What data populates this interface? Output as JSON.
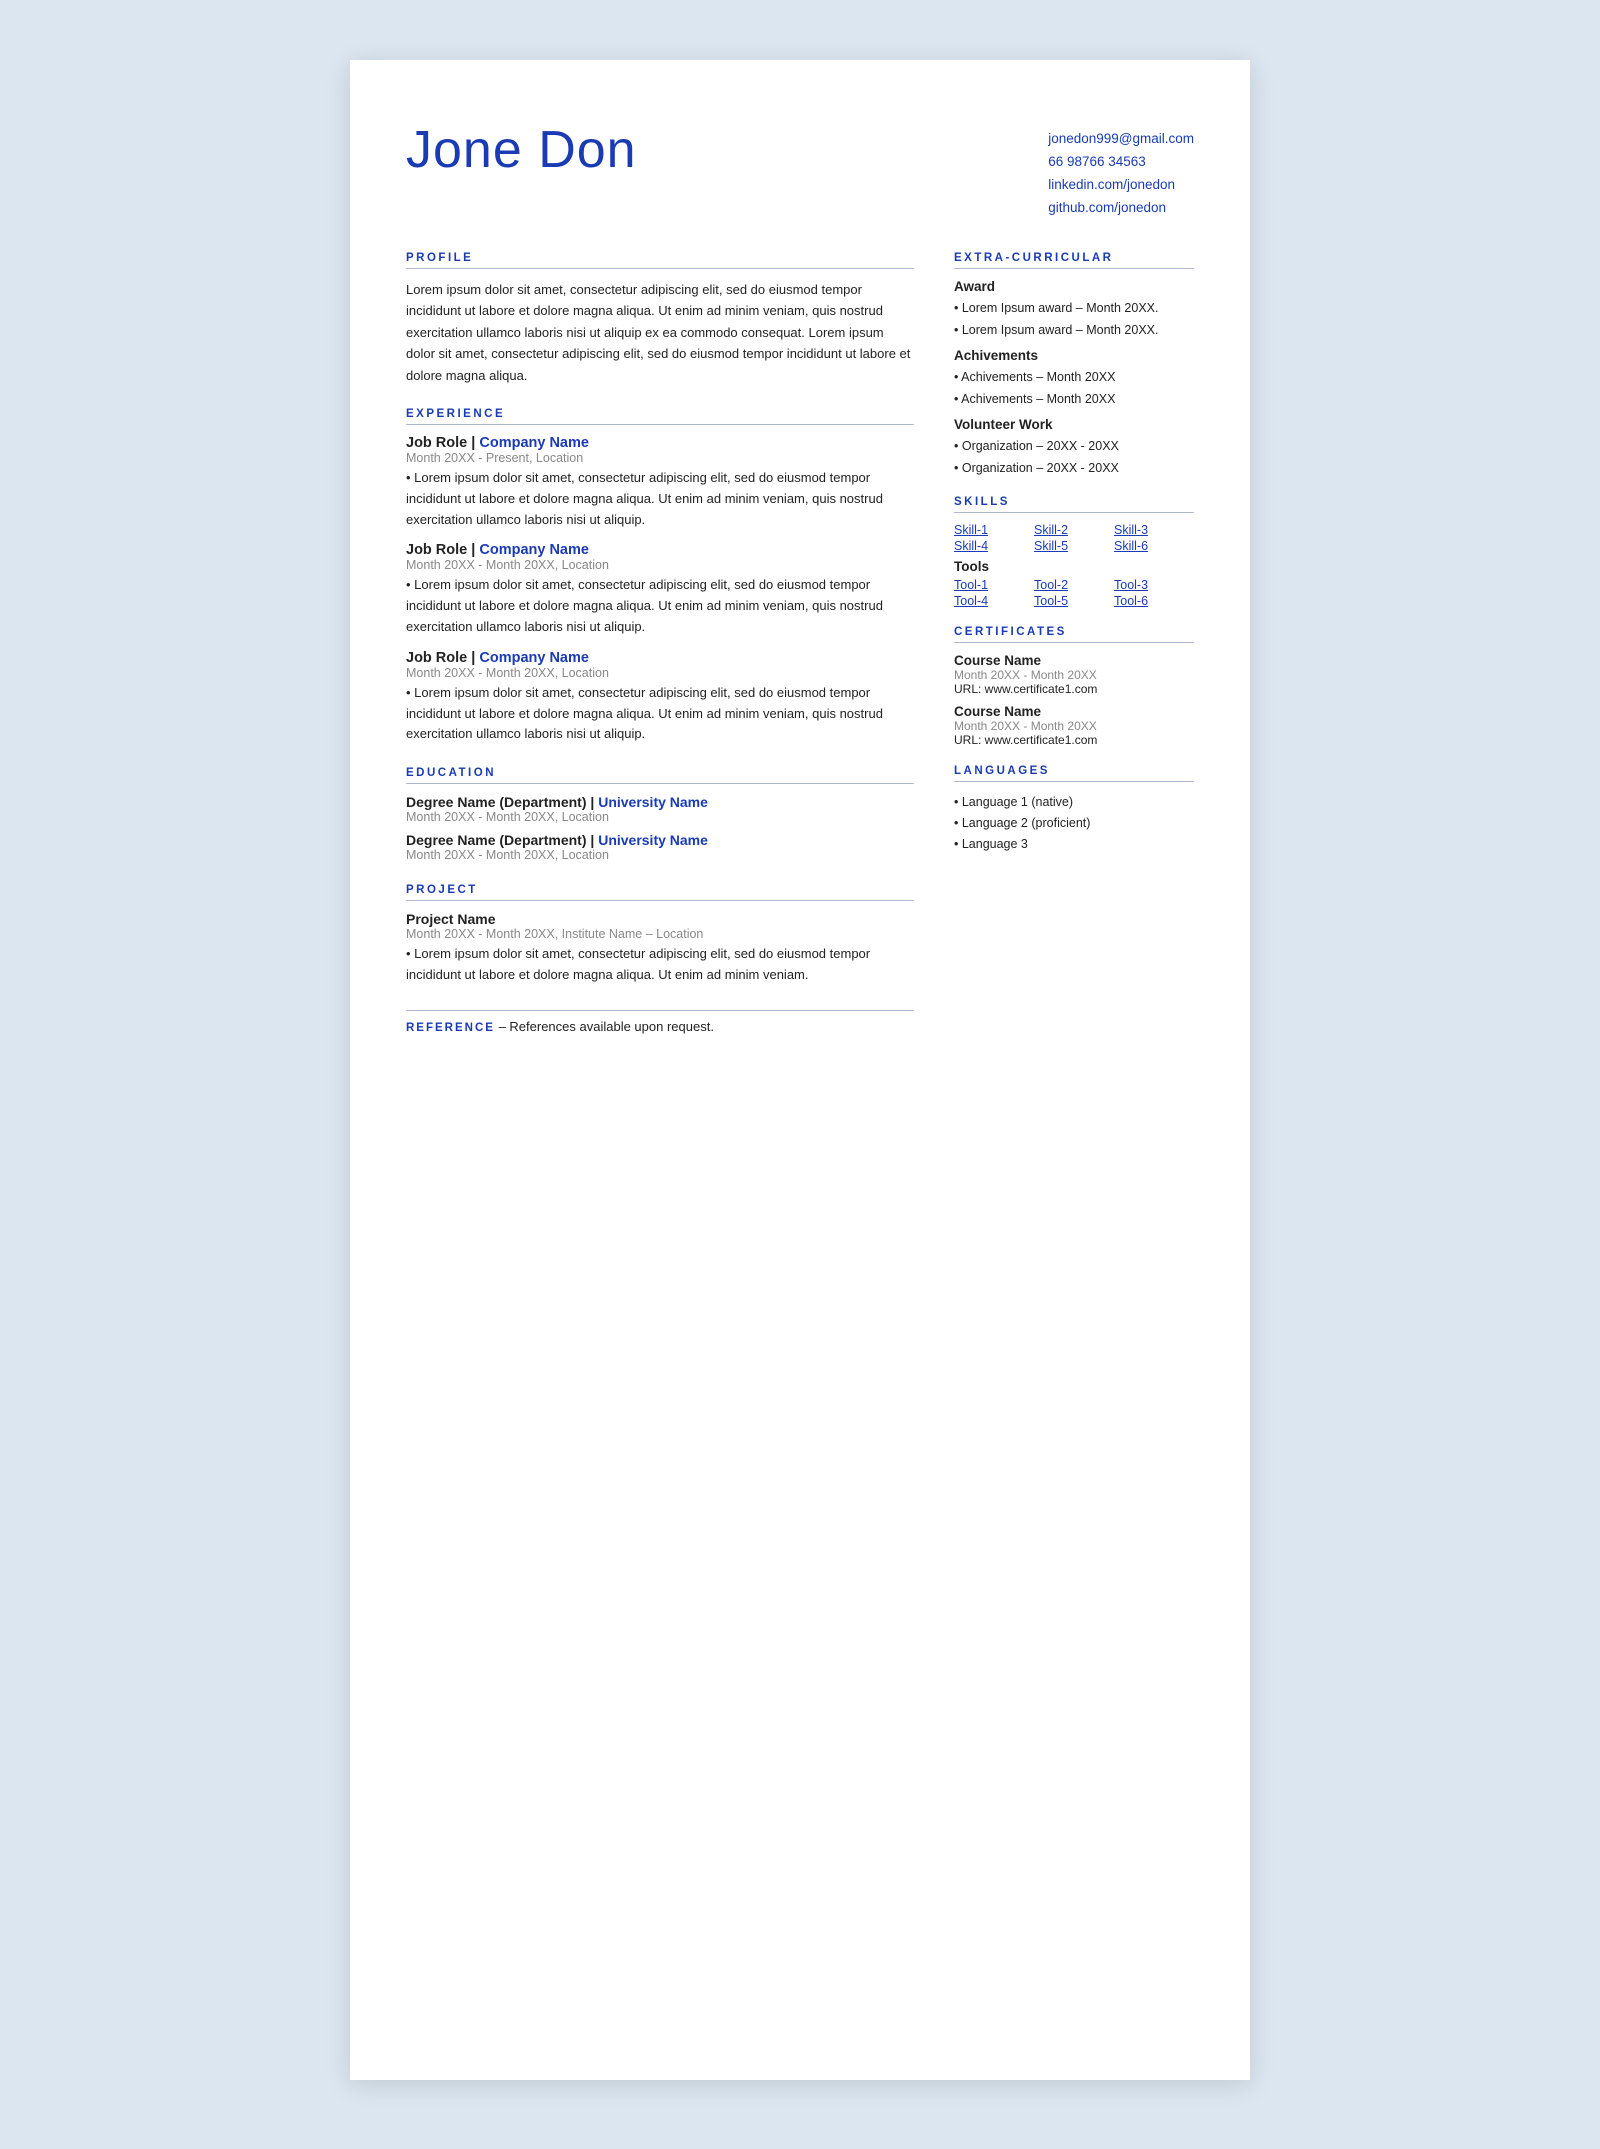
{
  "resume": {
    "name": "Jone Don",
    "contact": {
      "email": "jonedon999@gmail.com",
      "phone": "66 98766 34563",
      "linkedin": "linkedin.com/jonedon",
      "github": "github.com/jonedon"
    },
    "profile": {
      "section_title": "PROFILE",
      "text": "Lorem ipsum dolor sit amet, consectetur adipiscing elit, sed do eiusmod tempor incididunt ut labore et dolore magna aliqua. Ut enim ad minim veniam, quis nostrud exercitation ullamco laboris nisi ut aliquip ex ea commodo consequat. Lorem ipsum dolor sit amet, consectetur adipiscing elit, sed do eiusmod tempor incididunt ut labore et dolore magna aliqua."
    },
    "experience": {
      "section_title": "EXPERIENCE",
      "jobs": [
        {
          "role": "Job Role",
          "company": "Company Name",
          "date": "Month 20XX - Present, Location",
          "desc": "• Lorem ipsum dolor sit amet, consectetur adipiscing elit, sed do eiusmod tempor incididunt ut labore et dolore magna aliqua. Ut enim ad minim veniam, quis nostrud exercitation ullamco laboris nisi ut aliquip."
        },
        {
          "role": "Job Role",
          "company": "Company Name",
          "date": "Month 20XX - Month 20XX, Location",
          "desc": "• Lorem ipsum dolor sit amet, consectetur adipiscing elit, sed do eiusmod tempor incididunt ut labore et dolore magna aliqua. Ut enim ad minim veniam, quis nostrud exercitation ullamco laboris nisi ut aliquip."
        },
        {
          "role": "Job Role",
          "company": "Company Name",
          "date": "Month 20XX - Month 20XX, Location",
          "desc": "• Lorem ipsum dolor sit amet, consectetur adipiscing elit, sed do eiusmod tempor incididunt ut labore et dolore magna aliqua. Ut enim ad minim veniam, quis nostrud exercitation ullamco laboris nisi ut aliquip."
        }
      ]
    },
    "education": {
      "section_title": "EDUCATION",
      "degrees": [
        {
          "degree": "Degree Name (Department)",
          "university": "University Name",
          "date": "Month 20XX - Month 20XX, Location"
        },
        {
          "degree": "Degree Name (Department)",
          "university": "University Name",
          "date": "Month 20XX - Month 20XX, Location"
        }
      ]
    },
    "project": {
      "section_title": "PROJECT",
      "name": "Project Name",
      "date": "Month 20XX - Month 20XX, Institute Name – Location",
      "desc": "• Lorem ipsum dolor sit amet, consectetur adipiscing elit, sed do eiusmod tempor incididunt ut labore et dolore magna aliqua. Ut enim ad minim veniam."
    },
    "reference": {
      "label": "REFERENCE",
      "text": "– References available upon request."
    },
    "extra_curricular": {
      "section_title": "EXTRA-CURRICULAR",
      "award_label": "Award",
      "awards": [
        "• Lorem Ipsum award – Month 20XX.",
        "• Lorem Ipsum award – Month 20XX."
      ],
      "achievements_label": "Achivements",
      "achievements": [
        "• Achivements – Month 20XX",
        "• Achivements – Month 20XX"
      ],
      "volunteer_label": "Volunteer Work",
      "volunteer": [
        "• Organization – 20XX - 20XX",
        "• Organization – 20XX - 20XX"
      ]
    },
    "skills": {
      "section_title": "SKILLS",
      "skills": [
        "Skill-1",
        "Skill-2",
        "Skill-3",
        "Skill-4",
        "Skill-5",
        "Skill-6"
      ],
      "tools_label": "Tools",
      "tools": [
        "Tool-1",
        "Tool-2",
        "Tool-3",
        "Tool-4",
        "Tool-5",
        "Tool-6"
      ]
    },
    "certificates": {
      "section_title": "CERTIFICATES",
      "items": [
        {
          "course": "Course Name",
          "date": "Month 20XX - Month 20XX",
          "url": "URL: www.certificate1.com"
        },
        {
          "course": "Course Name",
          "date": "Month 20XX - Month 20XX",
          "url": "URL: www.certificate1.com"
        }
      ]
    },
    "languages": {
      "section_title": "LANGUAGES",
      "items": [
        "• Language 1 (native)",
        "• Language 2 (proficient)",
        "• Language 3"
      ]
    }
  }
}
